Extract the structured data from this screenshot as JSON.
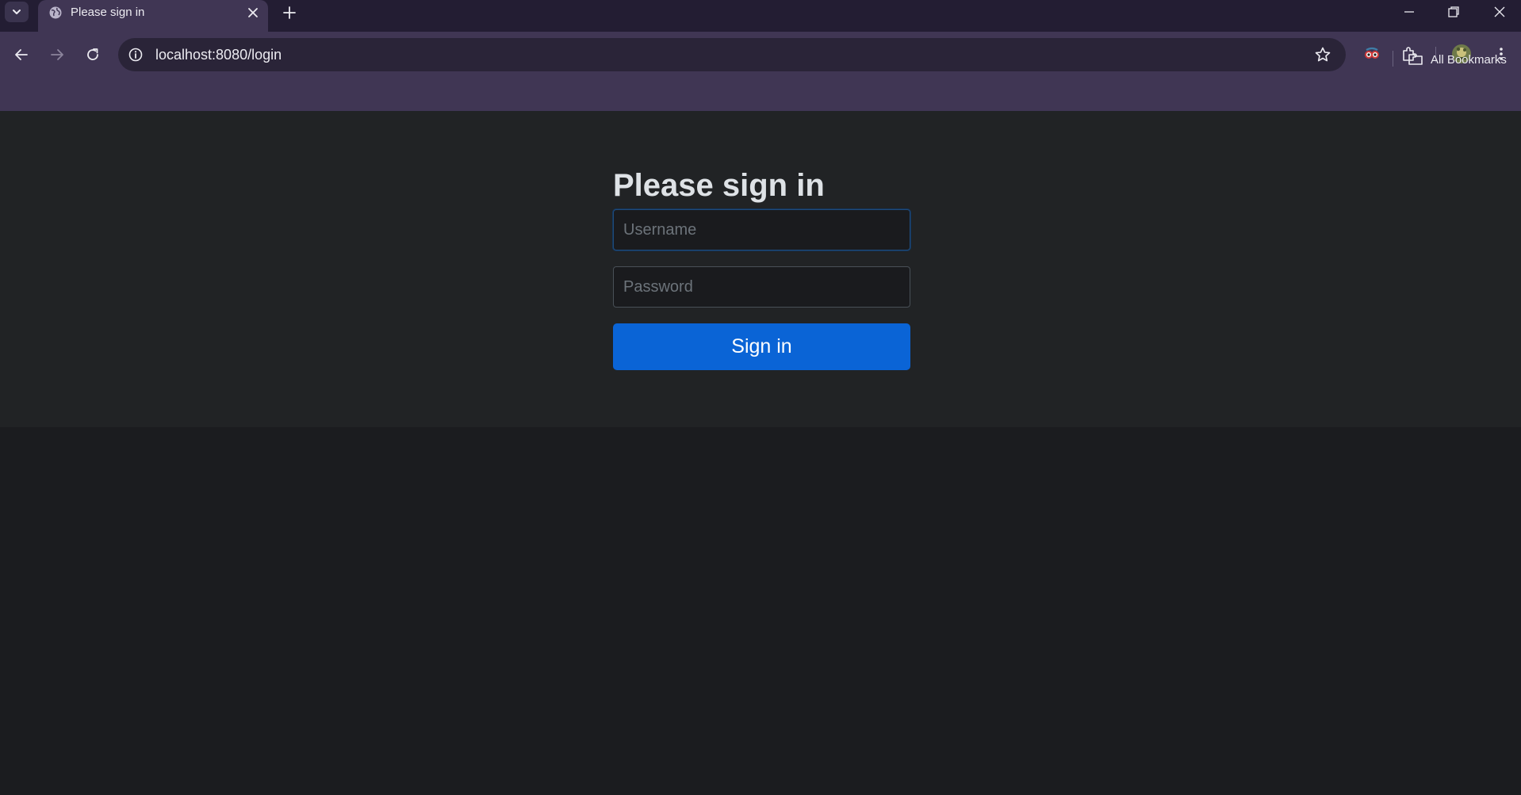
{
  "browser": {
    "tab": {
      "title": "Please sign in"
    },
    "address_bar": {
      "url": "localhost:8080/login"
    },
    "bookmarks_bar": {
      "all_bookmarks_label": "All Bookmarks"
    },
    "colors": {
      "frame": "#231d33",
      "toolbar": "#403654",
      "omnibox": "#2a2438"
    }
  },
  "login": {
    "heading": "Please sign in",
    "username": {
      "placeholder": "Username",
      "value": ""
    },
    "password": {
      "placeholder": "Password",
      "value": ""
    },
    "submit_label": "Sign in",
    "colors": {
      "button": "#0a64d6",
      "panel": "#212325",
      "background": "#1b1c1f"
    }
  }
}
